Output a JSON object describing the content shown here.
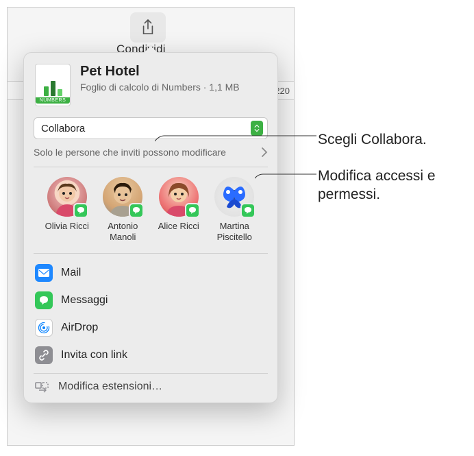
{
  "toolbar": {
    "share_label": "Condividi"
  },
  "ruler": {
    "tick": "220"
  },
  "document": {
    "title": "Pet Hotel",
    "subtitle": "Foglio di calcolo di Numbers · 1,1 MB",
    "extension_label": "NUMBERS"
  },
  "collaborate": {
    "select_label": "Collabora",
    "permission_text": "Solo le persone che inviti possono modificare"
  },
  "contacts": [
    {
      "name": "Olivia Ricci"
    },
    {
      "name": "Antonio Manoli"
    },
    {
      "name": "Alice Ricci"
    },
    {
      "name": "Martina Piscitello"
    }
  ],
  "options": {
    "mail": "Mail",
    "messages": "Messaggi",
    "airdrop": "AirDrop",
    "invite_link": "Invita con link",
    "edit_extensions": "Modifica estensioni…"
  },
  "callouts": {
    "choose_collaborate": "Scegli Collabora.",
    "modify_access": "Modifica accessi e permessi."
  },
  "colors": {
    "accent_green": "#3cb043",
    "messages_green": "#34c759",
    "mail_blue": "#1e88ff",
    "airdrop_blue": "#0a84ff",
    "link_gray": "#8e8e93"
  }
}
